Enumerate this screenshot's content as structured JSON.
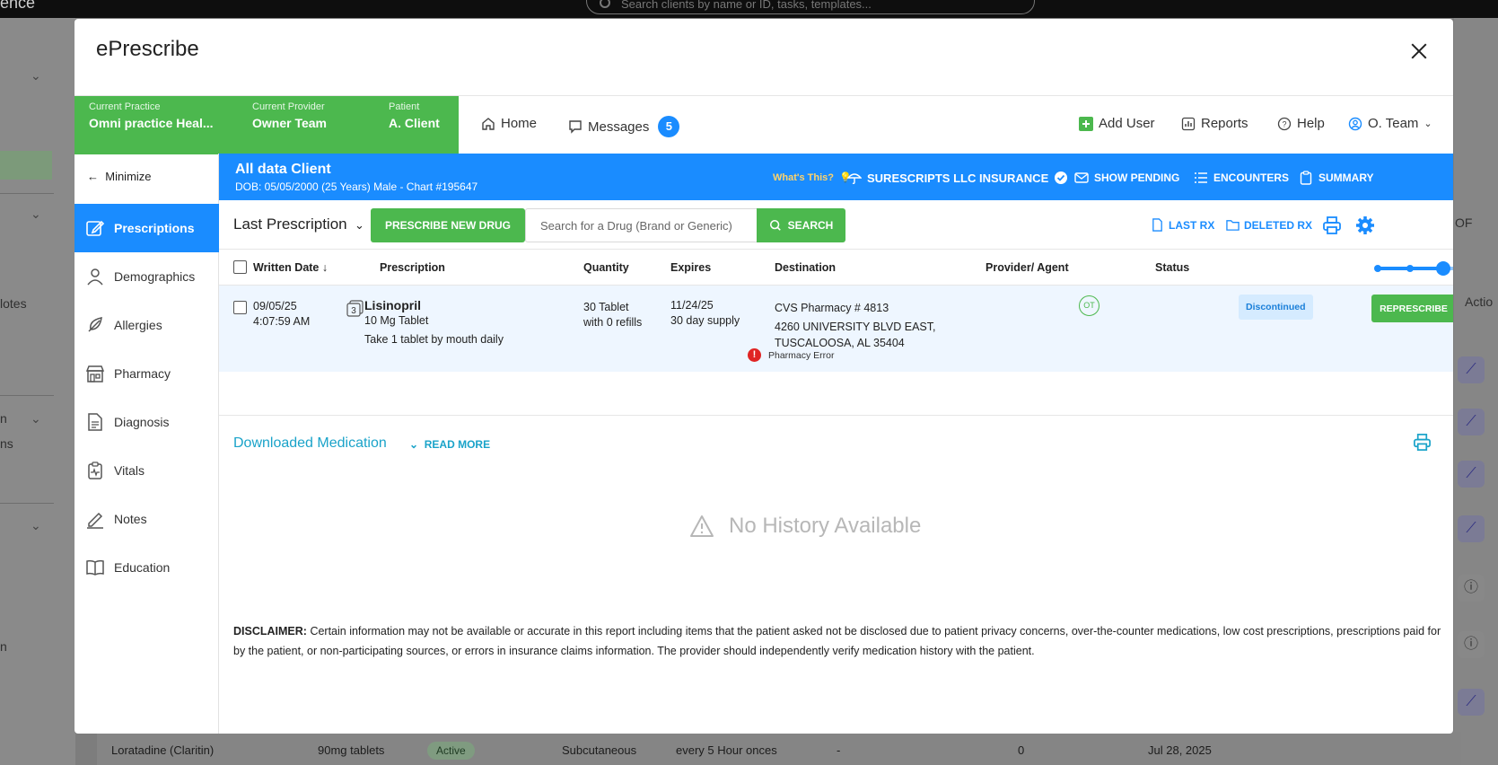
{
  "background": {
    "brand_fragment": "ence",
    "search_placeholder": "Search clients by name or ID, tasks, templates...",
    "left_texts": [
      "lotes",
      "n",
      "ns",
      "n"
    ],
    "right_fragments": [
      "OF",
      "Actio"
    ],
    "bottom_row": {
      "medication": "Loratadine (Claritin)",
      "dose": "90mg tablets",
      "status": "Active",
      "route": "Subcutaneous",
      "frequency": "every 5 Hour onces",
      "col1": "-",
      "col2": "0",
      "date": "Jul 28, 2025"
    }
  },
  "modal": {
    "title": "ePrescribe"
  },
  "context": {
    "practice_label": "Current Practice",
    "practice_value": "Omni practice Heal...",
    "provider_label": "Current Provider",
    "provider_value": "Owner Team",
    "patient_label": "Patient",
    "patient_value": "A. Client"
  },
  "nav": {
    "home": "Home",
    "messages": "Messages",
    "messages_count": "5",
    "add_user": "Add User",
    "reports": "Reports",
    "help": "Help",
    "user": "O. Team"
  },
  "sidebar": {
    "minimize": "Minimize",
    "items": [
      {
        "label": "Prescriptions",
        "icon": "edit-icon"
      },
      {
        "label": "Demographics",
        "icon": "person-icon"
      },
      {
        "label": "Allergies",
        "icon": "feather-icon"
      },
      {
        "label": "Pharmacy",
        "icon": "store-icon"
      },
      {
        "label": "Diagnosis",
        "icon": "document-icon"
      },
      {
        "label": "Vitals",
        "icon": "clipboard-pulse-icon"
      },
      {
        "label": "Notes",
        "icon": "pen-icon"
      },
      {
        "label": "Education",
        "icon": "book-icon"
      }
    ]
  },
  "patient": {
    "name": "All data Client",
    "dob_line": "DOB: 05/05/2000 (25 Years) Male - Chart #195647",
    "whats_this": "What's This?",
    "insurance": "SURESCRIPTS LLC INSURANCE",
    "show_pending": "SHOW PENDING",
    "encounters": "ENCOUNTERS",
    "summary": "SUMMARY"
  },
  "toolbar": {
    "view_select": "Last Prescription",
    "prescribe_new": "PRESCRIBE NEW DRUG",
    "search_placeholder": "Search for a Drug (Brand or Generic)",
    "search_button": "SEARCH",
    "last_rx": "LAST RX",
    "deleted_rx": "DELETED RX"
  },
  "table": {
    "headers": {
      "written_date": "Written Date",
      "prescription": "Prescription",
      "quantity": "Quantity",
      "expires": "Expires",
      "destination": "Destination",
      "provider": "Provider/ Agent",
      "status": "Status"
    },
    "rows": [
      {
        "date": "09/05/25",
        "time": "4:07:59 AM",
        "refill_count": "3",
        "drug": "Lisinopril",
        "strength": "10 Mg Tablet",
        "sig": "Take 1 tablet by mouth daily",
        "quantity": "30 Tablet",
        "refills": "with 0 refills",
        "expires": "11/24/25",
        "supply": "30 day supply",
        "pharmacy": "CVS Pharmacy # 4813",
        "address1": "4260 UNIVERSITY BLVD EAST,",
        "address2": "TUSCALOOSA, AL 35404",
        "error": "Pharmacy Error",
        "provider_initials": "OT",
        "status": "Discontinued",
        "action": "REPRESCRIBE"
      }
    ]
  },
  "downloaded": {
    "title": "Downloaded Medication",
    "read_more": "READ MORE",
    "empty": "No History Available"
  },
  "disclaimer": {
    "label": "DISCLAIMER:",
    "text": "Certain information may not be available or accurate in this report including items that the patient asked not be disclosed due to patient privacy concerns, over-the-counter medications, low cost prescriptions, prescriptions paid for by the patient, or non-participating sources, or errors in insurance claims information. The provider should independently verify medication history with the patient."
  },
  "colors": {
    "accent_blue": "#1a8cff",
    "green": "#4cb84e",
    "teal": "#1aa3c9",
    "error_red": "#e02424"
  }
}
